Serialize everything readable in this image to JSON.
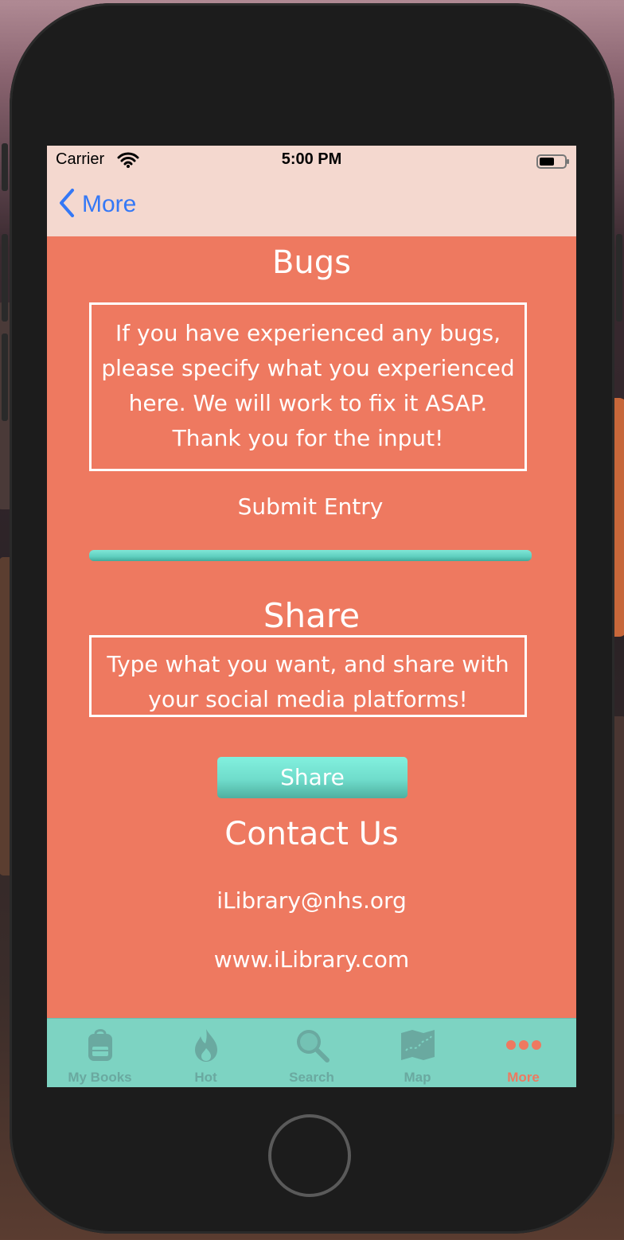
{
  "status": {
    "carrier": "Carrier",
    "time": "5:00 PM"
  },
  "nav": {
    "back_label": "More"
  },
  "bugs": {
    "title": "Bugs",
    "lines": [
      "If you have experienced any bugs,",
      "please specify what you experienced",
      "here. We will work to fix it ASAP.",
      "Thank you for the input!"
    ],
    "submit_label": "Submit Entry"
  },
  "share": {
    "title": "Share",
    "lines": [
      "Type what you want, and share with",
      "your social media platforms!"
    ],
    "button_label": "Share"
  },
  "contact": {
    "title": "Contact Us",
    "email": "iLibrary@nhs.org",
    "website": "www.iLibrary.com"
  },
  "tabs": [
    {
      "label": "My Books",
      "icon": "backpack-icon"
    },
    {
      "label": "Hot",
      "icon": "flame-icon"
    },
    {
      "label": "Search",
      "icon": "magnifier-icon"
    },
    {
      "label": "Map",
      "icon": "map-icon"
    },
    {
      "label": "More",
      "icon": "more-dots-icon",
      "active": true
    }
  ],
  "colors": {
    "background": "#ee7960",
    "nav_bar": "#f4d8cf",
    "tab_bar": "#7dd3c2",
    "accent_teal": "#7fe6d6",
    "link_blue": "#3478f6"
  }
}
